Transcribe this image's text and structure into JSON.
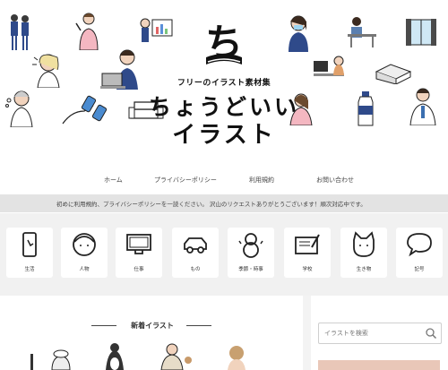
{
  "site": {
    "tagline": "フリーのイラスト素材集",
    "title_line1": "ちょうどいい",
    "title_line2": "イラスト"
  },
  "nav": [
    "ホーム",
    "プライバシーポリシー",
    "利用規約",
    "お問い合わせ"
  ],
  "notice": "初めに利用規約、プライバシーポリシーを一読ください。 沢山のリクエストありがとうございます！順次対応中です。",
  "categories": [
    {
      "label": "生活",
      "icon": "smartphone-icon"
    },
    {
      "label": "人物",
      "icon": "person-icon"
    },
    {
      "label": "仕事",
      "icon": "monitor-icon"
    },
    {
      "label": "もの",
      "icon": "car-icon"
    },
    {
      "label": "季節・時事",
      "icon": "snowman-icon"
    },
    {
      "label": "学校",
      "icon": "notebook-icon"
    },
    {
      "label": "生き物",
      "icon": "cat-icon"
    },
    {
      "label": "記号",
      "icon": "speech-bubble-icon"
    }
  ],
  "new_section": {
    "title": "新着イラスト"
  },
  "search": {
    "placeholder": "イラストを検索"
  }
}
